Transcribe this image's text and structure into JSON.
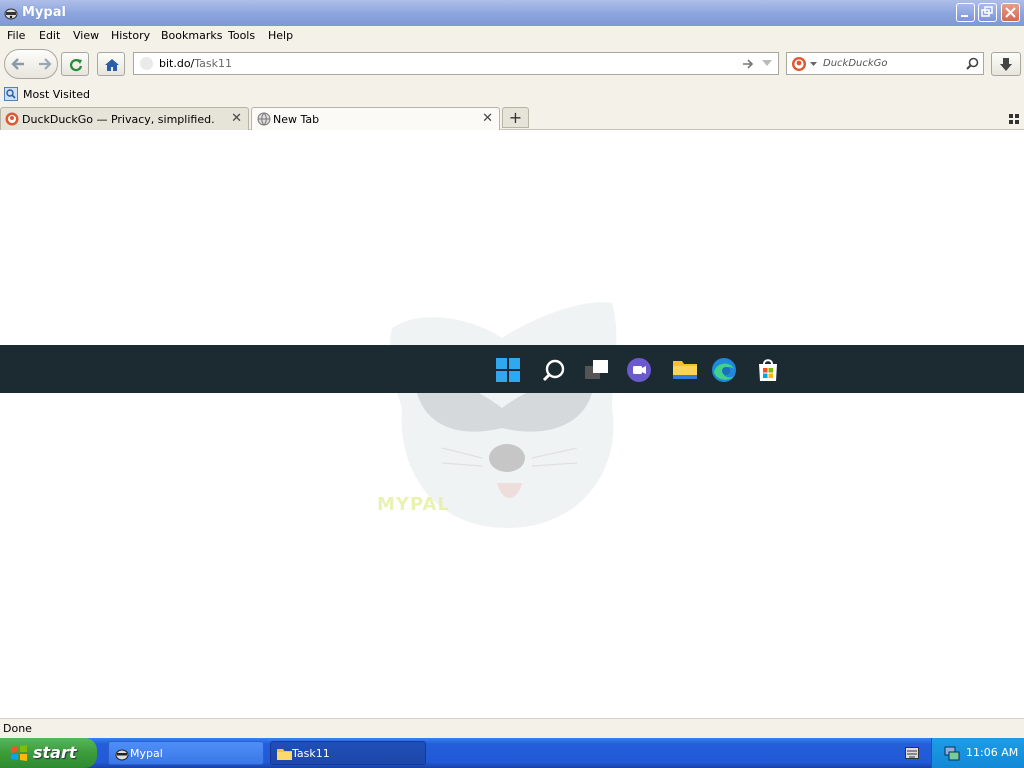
{
  "window": {
    "title": "Mypal"
  },
  "menu": {
    "items": [
      "File",
      "Edit",
      "View",
      "History",
      "Bookmarks",
      "Tools",
      "Help"
    ]
  },
  "navbar": {
    "url_host": "bit.do/",
    "url_path": "Task11",
    "search_placeholder": "DuckDuckGo"
  },
  "bookmarks": {
    "most_visited": "Most Visited"
  },
  "tabs": [
    {
      "label": "DuckDuckGo — Privacy, simplified.",
      "active": false
    },
    {
      "label": "New Tab",
      "active": true
    }
  ],
  "content": {
    "logo_text": "MYPAL"
  },
  "status": {
    "text": "Done"
  },
  "taskbar": {
    "start_label": "start",
    "items": [
      {
        "label": "Mypal",
        "icon": "raccoon-icon"
      },
      {
        "label": "Task11",
        "icon": "folder-icon"
      }
    ],
    "clock": "11:06 AM"
  },
  "win11_taskbar_icons": [
    "windows-start-icon",
    "search-icon",
    "task-view-icon",
    "teams-chat-icon",
    "file-explorer-icon",
    "edge-icon",
    "store-icon"
  ],
  "colors": {
    "xp_taskbar": "#245edb",
    "start_green": "#3c9c3c",
    "win11_bar": "#1c2b32"
  }
}
